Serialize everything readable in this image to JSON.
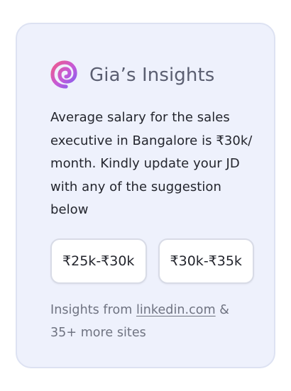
{
  "card": {
    "logo_icon": "gia-spiral-logo-icon",
    "title": "Gia’s Insights",
    "message": "Average salary for the sales executive in Bangalore is ₹30k/ month. Kindly update your JD with any of the suggestion below",
    "suggestions": [
      {
        "label": "₹25k-₹30k"
      },
      {
        "label": "₹30k-₹35k"
      }
    ],
    "footer": {
      "prefix": "Insights from ",
      "link_text": "linkedin.com",
      "suffix_line1": " &",
      "suffix_line2": "35+ more sites"
    }
  },
  "colors": {
    "card_background": "#eef1fc",
    "card_border": "#dde2f2",
    "title": "#5a5e70",
    "body_text": "#23252d",
    "muted_text": "#6f7381",
    "logo_gradient": [
      "#e8588c",
      "#8a5ef0"
    ]
  }
}
